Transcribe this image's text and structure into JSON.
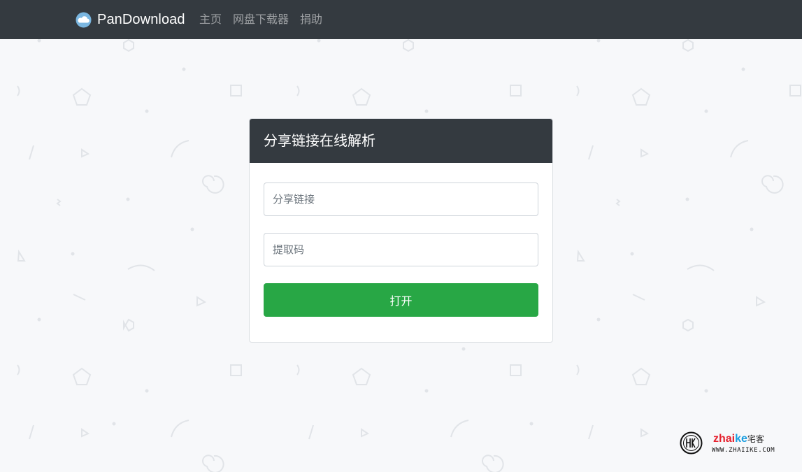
{
  "navbar": {
    "brand_name": "PanDownload",
    "brand_icon": "cloud-icon",
    "links": [
      {
        "label": "主页"
      },
      {
        "label": "网盘下载器"
      },
      {
        "label": "捐助"
      }
    ],
    "background": "#343a40"
  },
  "form_card": {
    "title": "分享链接在线解析",
    "share_link": {
      "placeholder": "分享链接",
      "value": ""
    },
    "extract_code": {
      "placeholder": "提取码",
      "value": ""
    },
    "open_button_label": "打开",
    "button_color": "#28a745"
  },
  "watermark": {
    "brand_part1": "zhai",
    "brand_part2": "ke",
    "brand_cn": "宅客",
    "domain": "WWW.ZHAIIKE.COM"
  },
  "colors": {
    "page_background": "#f7f8fa",
    "header_dark": "#343a40",
    "accent_green": "#28a745",
    "cloud_blue": "#7ab6e0"
  }
}
